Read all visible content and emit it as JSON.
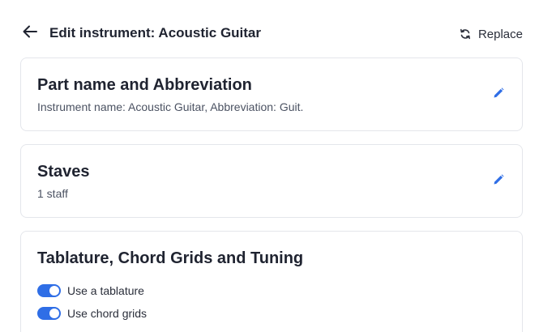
{
  "header": {
    "title": "Edit instrument: Acoustic Guitar",
    "back_icon": "arrow-left-icon",
    "replace_label": "Replace",
    "replace_icon": "refresh-icon"
  },
  "cards": {
    "part": {
      "title": "Part name and Abbreviation",
      "subtitle": "Instrument name: Acoustic Guitar, Abbreviation: Guit.",
      "edit_icon": "pencil-icon"
    },
    "staves": {
      "title": "Staves",
      "subtitle": "1 staff",
      "edit_icon": "pencil-icon"
    },
    "tablature": {
      "title": "Tablature, Chord Grids and Tuning",
      "toggles": [
        {
          "label": "Use a tablature",
          "on": true
        },
        {
          "label": "Use chord grids",
          "on": true
        }
      ]
    }
  },
  "colors": {
    "accent": "#2f6ee6",
    "text": "#1f2330",
    "muted": "#4b5262",
    "border": "#e4e6eb"
  }
}
